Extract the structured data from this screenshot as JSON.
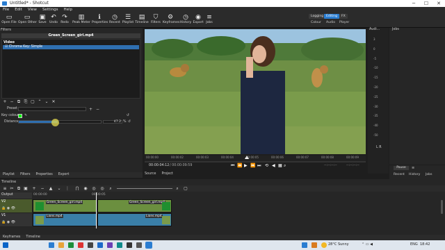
{
  "window": {
    "title": "Untitled* - Shotcut",
    "min": "─",
    "max": "☐",
    "close": "✕"
  },
  "menu": [
    "File",
    "Edit",
    "View",
    "Settings",
    "Help"
  ],
  "toolbar": [
    {
      "label": "Open File",
      "icon": "folder-open-icon",
      "glyph": "▭"
    },
    {
      "label": "Open Other",
      "icon": "folder-icon",
      "glyph": "▭"
    },
    {
      "label": "Save",
      "icon": "save-icon",
      "glyph": "▣"
    },
    {
      "label": "Undo",
      "icon": "undo-icon",
      "glyph": "↶"
    },
    {
      "label": "Redo",
      "icon": "redo-icon",
      "glyph": "↷"
    },
    {
      "label": "Peak Meter",
      "icon": "peak-meter-icon",
      "glyph": "▥"
    },
    {
      "label": "Properties",
      "icon": "properties-icon",
      "glyph": "ℹ"
    },
    {
      "label": "Recent",
      "icon": "recent-icon",
      "glyph": "◷"
    },
    {
      "label": "Playlist",
      "icon": "playlist-icon",
      "glyph": "☰"
    },
    {
      "label": "Timeline",
      "icon": "timeline-icon",
      "glyph": "▤"
    },
    {
      "label": "Filters",
      "icon": "filters-icon",
      "glyph": "⛉"
    },
    {
      "label": "Keyframes",
      "icon": "keyframes-icon",
      "glyph": "⚙"
    },
    {
      "label": "History",
      "icon": "history-icon",
      "glyph": "◷"
    },
    {
      "label": "Export",
      "icon": "export-icon",
      "glyph": "◉"
    },
    {
      "label": "Jobs",
      "icon": "jobs-icon",
      "glyph": "≡"
    }
  ],
  "layouts": {
    "top": [
      "Logging",
      "Editing",
      "FX"
    ],
    "active": "Editing",
    "bottom": [
      "Colour",
      "Audio",
      "Player"
    ]
  },
  "filters_panel": {
    "title": "Filters",
    "clip_name": "Green_Screen_girl.mp4",
    "section": "Video",
    "items": [
      "Chroma Key: Simple"
    ],
    "buttons": [
      "+",
      "−",
      "⧉",
      "⎘",
      "▢",
      "⌃",
      "⌄",
      "✕"
    ],
    "preset_label": "Preset",
    "key_colour_label": "Key colour",
    "distance_label": "Distance",
    "distance_value": "47.2",
    "distance_unit": "%",
    "distance_fraction": 0.472
  },
  "left_tabs": [
    "Playlist",
    "Filters",
    "Properties",
    "Export"
  ],
  "player": {
    "ruler": [
      "00:00:00",
      "00:00:02",
      "00:00:03",
      "00:00:04",
      "00:00:05",
      "00:00:06",
      "00:00:07",
      "00:00:08",
      "00:00:09"
    ],
    "current_time": "00:00:04:12",
    "duration": "/ 00:00:09:59",
    "in_point": "--:--:--:--",
    "out_point": "--:--:--:--",
    "tabs": [
      "Source",
      "Project"
    ]
  },
  "audio_panel": {
    "title": "Audi...",
    "scale": [
      "3",
      "0",
      "-5",
      "-10",
      "-15",
      "-20",
      "-25",
      "-30",
      "-35",
      "-40",
      "-50"
    ],
    "lr": "L R"
  },
  "jobs_panel": {
    "title": "Jobs",
    "pause_label": "Pause",
    "tabs": [
      "Recent",
      "History",
      "Jobs"
    ]
  },
  "timeline": {
    "title": "Timeline",
    "output_label": "Output",
    "ruler_start": "00:00:00",
    "ruler_mark": "00:00:05",
    "tracks": [
      {
        "name": "V2",
        "clips": [
          "Green_Screen_girl.mp4",
          "Green_Screen_girl.mp4"
        ]
      },
      {
        "name": "V1",
        "clips": [
          "Lions.mp4",
          "Lions.mp4"
        ]
      }
    ]
  },
  "bottom_tabs": [
    "Keyframes",
    "Timeline"
  ],
  "taskbar": {
    "weather": "28°C  Sunny",
    "lang": "ENG",
    "time": "18:42"
  },
  "colors": {
    "accent": "#2a7dd1",
    "key_colour": "#00ff00",
    "v2_clip": "#6b8f3f",
    "v1_clip": "#3a7fa8"
  }
}
